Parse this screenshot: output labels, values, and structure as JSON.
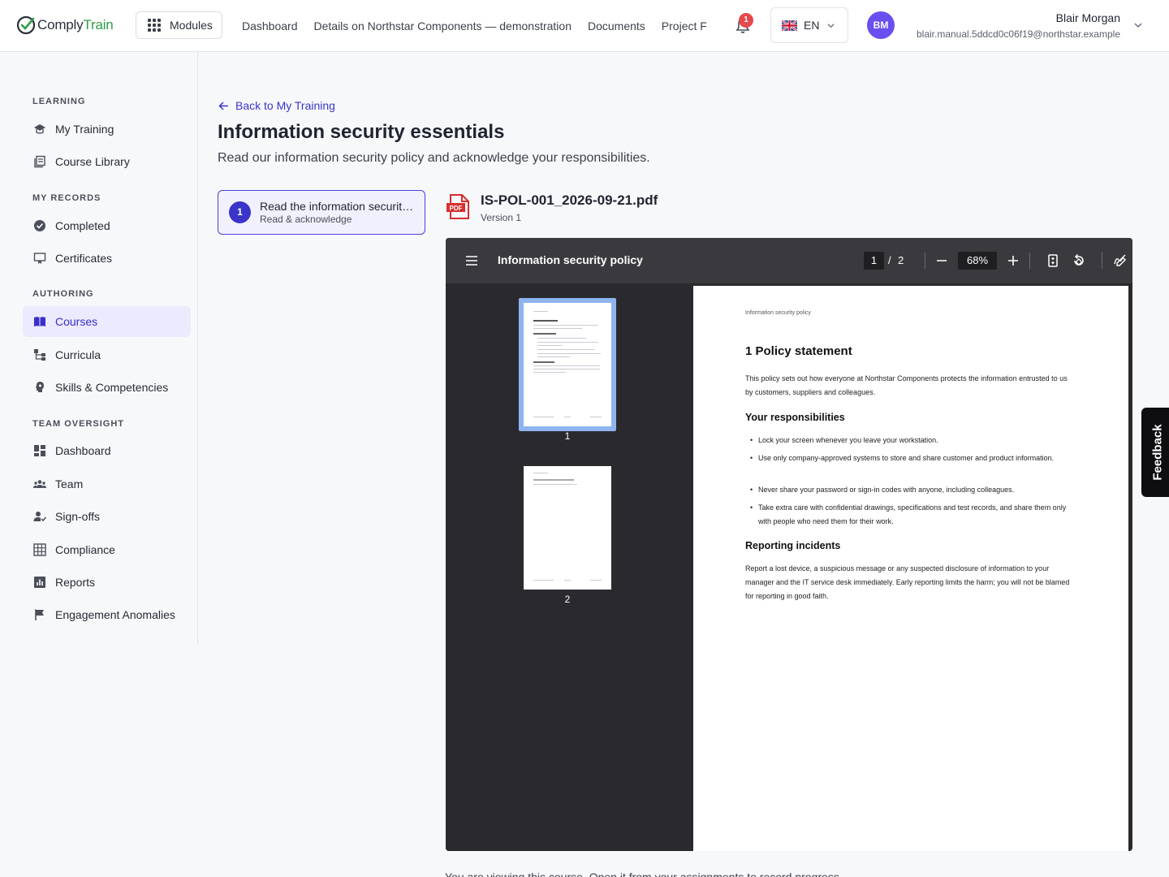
{
  "app": {
    "brand_a": "Comply",
    "brand_b": "Train"
  },
  "header": {
    "modules_label": "Modules",
    "nav": [
      "Dashboard",
      "Details on Northstar Components — demonstration",
      "Documents",
      "Project F"
    ],
    "notification_count": "1",
    "language": "EN",
    "user": {
      "initials": "BM",
      "name": "Blair Morgan",
      "email": "blair.manual.5ddcd0c06f19@northstar.example"
    }
  },
  "sidebar": {
    "sections": [
      {
        "label": "LEARNING",
        "items": [
          {
            "label": "My Training",
            "icon": "graduation-cap-icon"
          },
          {
            "label": "Course Library",
            "icon": "library-icon"
          }
        ]
      },
      {
        "label": "MY RECORDS",
        "items": [
          {
            "label": "Completed",
            "icon": "check-circle-icon"
          },
          {
            "label": "Certificates",
            "icon": "certificate-icon"
          }
        ]
      },
      {
        "label": "AUTHORING",
        "items": [
          {
            "label": "Courses",
            "icon": "book-icon",
            "active": true
          },
          {
            "label": "Curricula",
            "icon": "hierarchy-icon"
          },
          {
            "label": "Skills & Competencies",
            "icon": "skills-icon"
          }
        ]
      },
      {
        "label": "TEAM OVERSIGHT",
        "items": [
          {
            "label": "Dashboard",
            "icon": "dashboard-icon"
          },
          {
            "label": "Team",
            "icon": "team-icon"
          },
          {
            "label": "Sign-offs",
            "icon": "user-check-icon"
          },
          {
            "label": "Compliance",
            "icon": "table-icon"
          },
          {
            "label": "Reports",
            "icon": "bar-chart-icon"
          },
          {
            "label": "Engagement Anomalies",
            "icon": "flag-icon"
          }
        ]
      }
    ]
  },
  "main": {
    "back_label": "Back to My Training",
    "title": "Information security essentials",
    "subtitle": "Read our information security policy and acknowledge your responsibilities.",
    "step": {
      "number": "1",
      "title": "Read the information security policy",
      "subtitle": "Read & acknowledge"
    },
    "file": {
      "name": "IS-POL-001_2026-09-21.pdf",
      "version": "Version 1"
    },
    "bottom_text": "You are viewing this course. Open it from your assignments to record progress."
  },
  "viewer": {
    "title": "Information security policy",
    "current_page": "1",
    "slash": "/",
    "total_pages": "2",
    "zoom": "68%",
    "thumb_labels": [
      "1",
      "2"
    ],
    "page": {
      "running_header": "Information security policy",
      "heading": "1 Policy statement",
      "intro": "This policy sets out how everyone at Northstar Components protects the information entrusted to us by customers, suppliers and colleagues.",
      "resp_heading": "Your responsibilities",
      "responsibilities": [
        "Lock your screen whenever you leave your workstation.",
        "Use only company-approved systems to store and share customer and product information.",
        "Never share your password or sign-in codes with anyone, including colleagues.",
        "Take extra care with confidential drawings, specifications and test records, and share them only with people who need them for their work."
      ],
      "incidents_heading": "Reporting incidents",
      "incidents_text": "Report a lost device, a suspicious message or any suspected disclosure of information to your manager and the IT service desk immediately. Early reporting limits the harm; you will not be blamed for reporting in good faith."
    }
  },
  "feedback_label": "Feedback",
  "colors": {
    "accent": "#3b34c9",
    "brand_green": "#2e9d4a",
    "badge": "#e5484d",
    "viewer_bg": "#2a2a2e"
  }
}
